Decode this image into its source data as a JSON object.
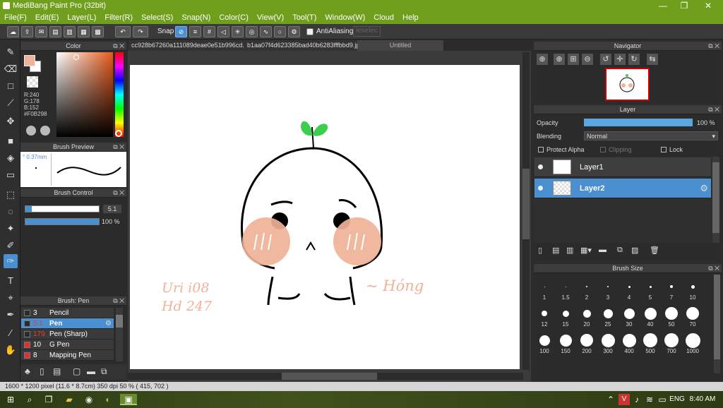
{
  "window": {
    "title": "MediBang Paint Pro (32bit)",
    "min": "—",
    "max": "❐",
    "close": "✕"
  },
  "menu": [
    "File(F)",
    "Edit(E)",
    "Layer(L)",
    "Filter(R)",
    "Select(S)",
    "Snap(N)",
    "Color(C)",
    "View(V)",
    "Tool(T)",
    "Window(W)",
    "Cloud",
    "Help"
  ],
  "toolbar": {
    "snap": "Snap",
    "antialiasing": "AntiAliasing",
    "disabled_field": "leselec"
  },
  "color_panel": {
    "title": "Color",
    "r": "R:240",
    "g": "G:178",
    "b": "B:152",
    "hex": "#F0B298",
    "primary": "#f0b298"
  },
  "brush_preview": {
    "title": "Brush Preview",
    "size": "° 0.37mm"
  },
  "brush_control": {
    "title": "Brush Control",
    "size_value": "5.1",
    "opacity_value": "100 %"
  },
  "brush_list": {
    "title": "Brush: Pen",
    "items": [
      {
        "size": "3",
        "name": "Pencil",
        "color": "#2b2b2b"
      },
      {
        "size": "5.1",
        "name": "Pen",
        "color": "#2b2b2b"
      },
      {
        "size": "179",
        "name": "Pen (Sharp)",
        "color": "#2b2b2b"
      },
      {
        "size": "10",
        "name": "G Pen",
        "color": "#e03030"
      },
      {
        "size": "8",
        "name": "Mapping Pen",
        "color": "#e03030"
      }
    ]
  },
  "tabs": [
    "cc928b67260a111089deae0e51b996cd.jpg",
    "b1aa07f4d62338​5bad40b6283fff​bbd9.jpg",
    "Untitled"
  ],
  "canvas": {
    "note1": "Uri i08",
    "note2": "Hd 247",
    "signature": "~ Hóng"
  },
  "navigator": {
    "title": "Navigator"
  },
  "layer_panel": {
    "title": "Layer",
    "opacity_label": "Opacity",
    "opacity_value": "100 %",
    "blending_label": "Blending",
    "blending_value": "Normal",
    "protect_alpha": "Protect Alpha",
    "clipping": "Clipping",
    "lock": "Lock",
    "layers": [
      {
        "name": "Layer1"
      },
      {
        "name": "Layer2"
      }
    ]
  },
  "brush_size": {
    "title": "Brush Size",
    "sizes": [
      "1",
      "1.5",
      "2",
      "3",
      "4",
      "5",
      "7",
      "10",
      "12",
      "15",
      "20",
      "25",
      "30",
      "40",
      "50",
      "70",
      "100",
      "150",
      "200",
      "300",
      "400",
      "500",
      "700",
      "1000"
    ]
  },
  "status": {
    "text": "1600 * 1200 pixel  (11.6 * 8.7cm)  350 dpi  50 %  ( 415, 702 )"
  },
  "taskbar": {
    "lang": "ENG",
    "time": "8:40 AM"
  }
}
